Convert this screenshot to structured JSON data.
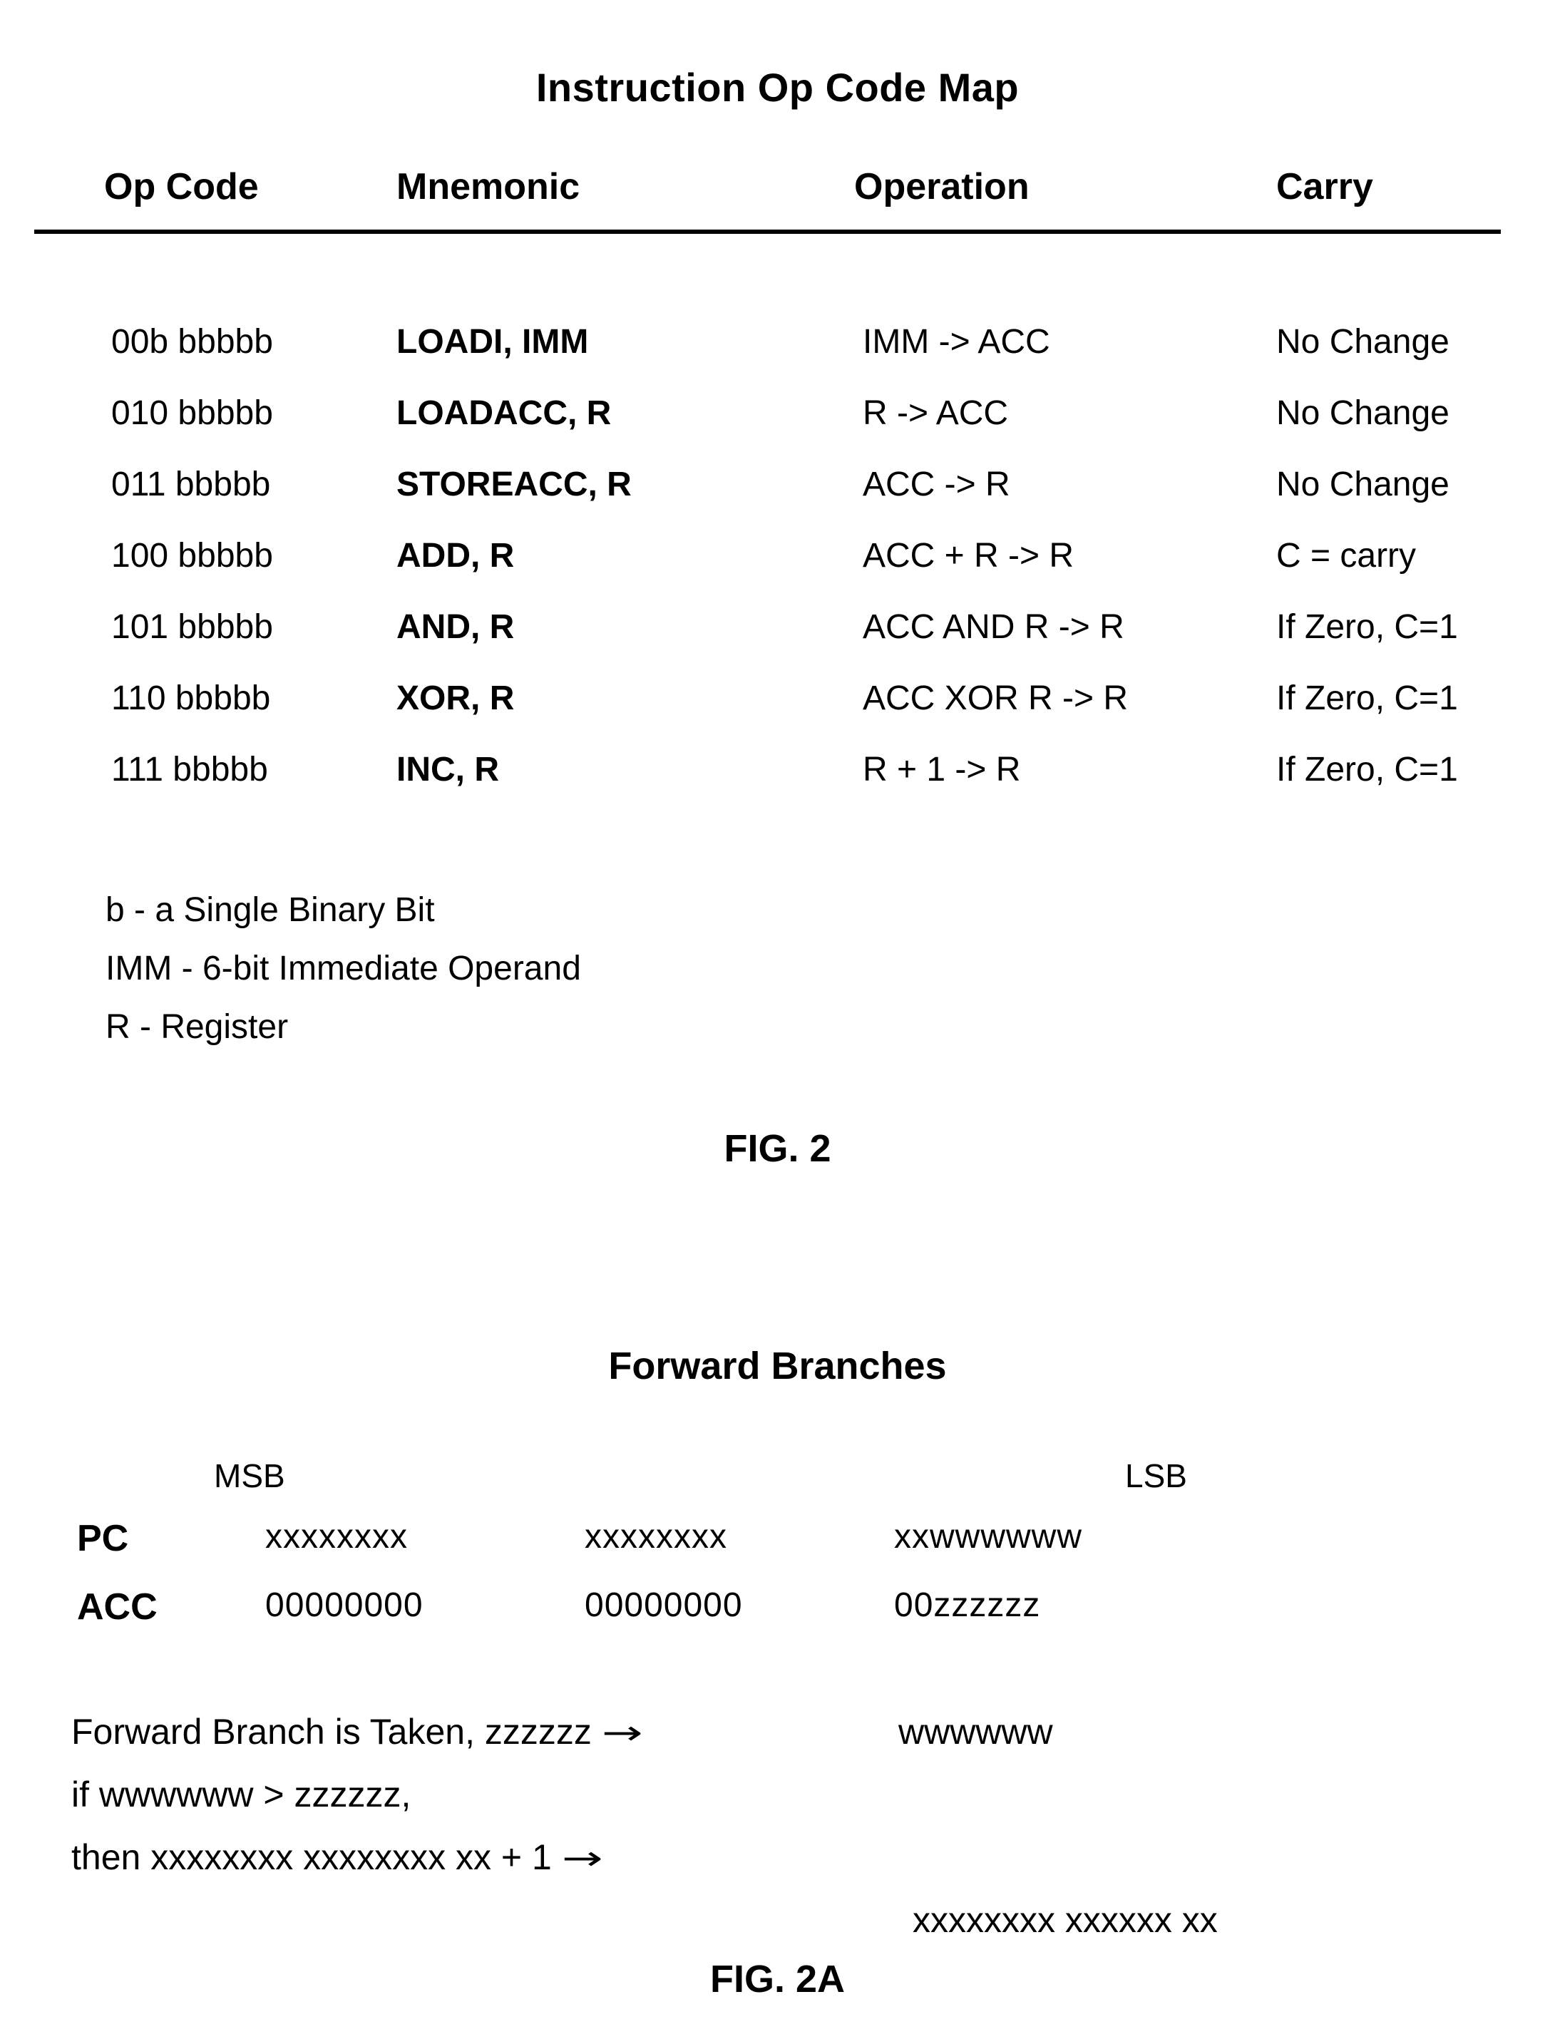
{
  "figure_2": {
    "title": "Instruction Op Code Map",
    "columns": [
      "Op Code",
      "Mnemonic",
      "Operation",
      "Carry"
    ],
    "rows": [
      {
        "op_code": "00b bbbbb",
        "mnemonic": "LOADI, IMM",
        "operation": "IMM -> ACC",
        "carry": "No Change"
      },
      {
        "op_code": "010 bbbbb",
        "mnemonic": "LOADACC, R",
        "operation": "R -> ACC",
        "carry": "No Change"
      },
      {
        "op_code": "011 bbbbb",
        "mnemonic": "STOREACC, R",
        "operation": "ACC -> R",
        "carry": "No Change"
      },
      {
        "op_code": "100 bbbbb",
        "mnemonic": "ADD, R",
        "operation": "ACC + R -> R",
        "carry": "C = carry"
      },
      {
        "op_code": "101 bbbbb",
        "mnemonic": "AND, R",
        "operation": "ACC AND R -> R",
        "carry": "If Zero, C=1"
      },
      {
        "op_code": "110 bbbbb",
        "mnemonic": "XOR, R",
        "operation": "ACC XOR R -> R",
        "carry": "If Zero, C=1"
      },
      {
        "op_code": "111 bbbbb",
        "mnemonic": "INC, R",
        "operation": "R + 1 -> R",
        "carry": "If Zero, C=1"
      }
    ],
    "legend": [
      "b - a Single Binary Bit",
      "IMM - 6-bit Immediate Operand",
      "R - Register"
    ],
    "caption": "FIG. 2"
  },
  "figure_2a": {
    "title": "Forward Branches",
    "msb_label": "MSB",
    "lsb_label": "LSB",
    "registers": [
      {
        "name": "PC",
        "group_1": "xxxxxxxx",
        "group_2": "xxxxxxxx",
        "group_3": "xxwwwwww"
      },
      {
        "name": "ACC",
        "group_1": "00000000",
        "group_2": "00000000",
        "group_3": "00zzzzzz"
      }
    ],
    "condition": {
      "line_1_left": "Forward Branch is Taken, zzzzzz",
      "line_1_arrow": "→",
      "line_1_right": "wwwwww",
      "line_2_left": "if wwwwww > zzzzzz,",
      "line_3_left": "then xxxxxxxx xxxxxxxx xx + 1",
      "line_3_arrow": "→",
      "line_3_right": "xxxxxxxx xxxxxx xx"
    },
    "caption": "FIG. 2A"
  }
}
